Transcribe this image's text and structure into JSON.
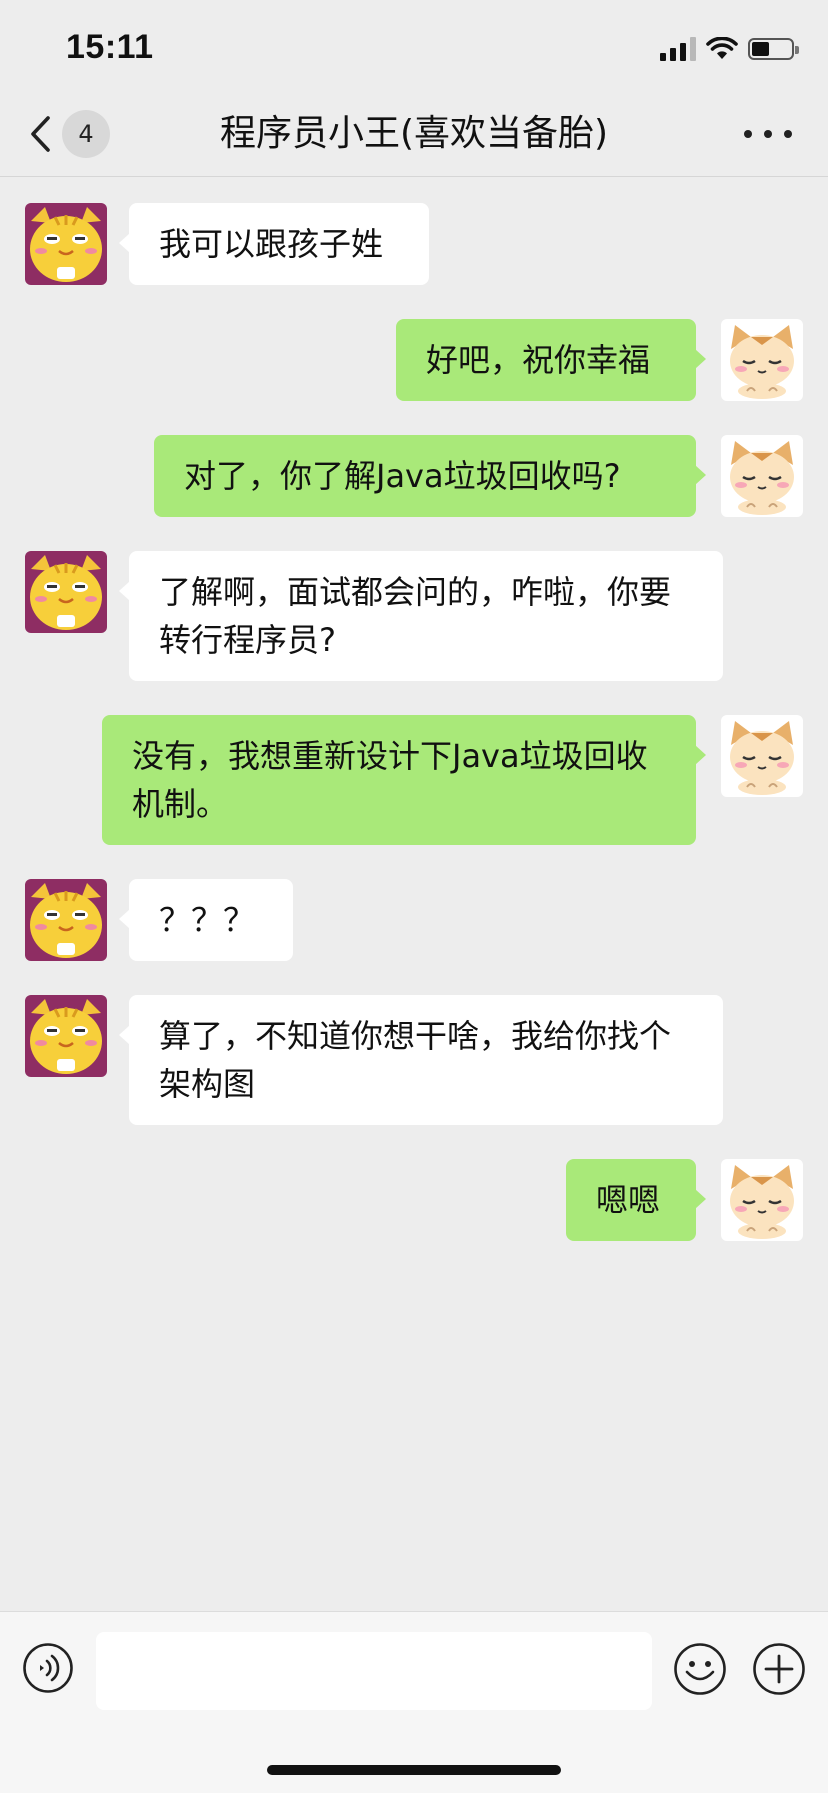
{
  "status_bar": {
    "time": "15:11",
    "battery_level": 0.45
  },
  "nav": {
    "back_badge": "4",
    "title": "程序员小王(喜欢当备胎)",
    "more_icon": "more-dots-icon"
  },
  "messages": [
    {
      "from": "contact",
      "text": "我可以跟孩子姓"
    },
    {
      "from": "me",
      "text": "好吧，祝你幸福"
    },
    {
      "from": "me",
      "text": "对了，你了解Java垃圾回收吗?"
    },
    {
      "from": "contact",
      "text": "了解啊，面试都会问的，咋啦，你要转行程序员?"
    },
    {
      "from": "me",
      "text": "没有，我想重新设计下Java垃圾回收机制。"
    },
    {
      "from": "contact",
      "text": "？？？"
    },
    {
      "from": "contact",
      "text": "算了，不知道你想干啥，我给你找个架构图"
    },
    {
      "from": "me",
      "text": "嗯嗯"
    }
  ],
  "input_bar": {
    "placeholder": "",
    "voice_icon": "voice-icon",
    "emoji_icon": "emoji-icon",
    "plus_icon": "plus-icon"
  },
  "colors": {
    "background": "#EDEDED",
    "outgoing_bubble": "#A9E979",
    "incoming_bubble": "#FFFFFF"
  }
}
